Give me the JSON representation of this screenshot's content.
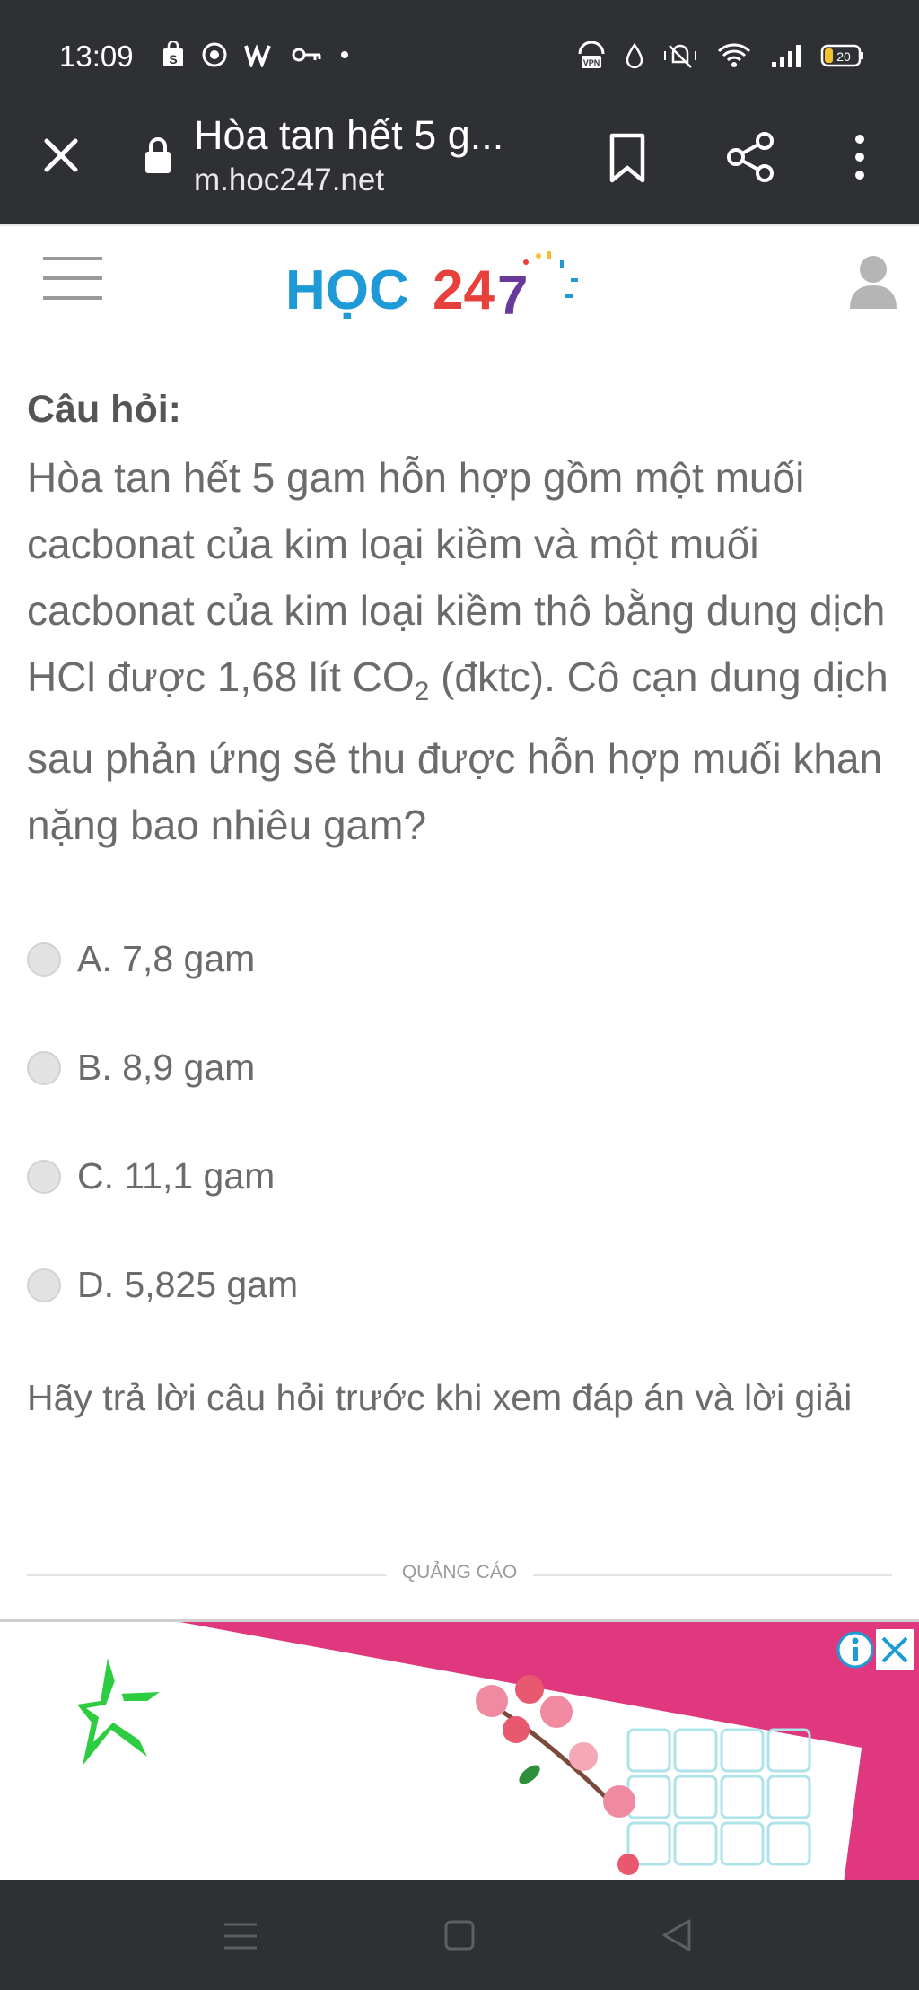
{
  "status_bar": {
    "time": "13:09",
    "battery": "20",
    "left_icons": [
      "shopping-bag-icon",
      "chrome-icon",
      "w-app-icon",
      "key-icon",
      "dot-icon"
    ],
    "right_icons": [
      "vpn-icon",
      "drop-icon",
      "mute-icon",
      "wifi-icon",
      "signal-icon",
      "battery-icon"
    ]
  },
  "browser_toolbar": {
    "page_title": "Hòa tan hết 5 g...",
    "url": "m.hoc247.net"
  },
  "site_header": {
    "logo_text_blue": "HỌC",
    "logo_text_red": "24",
    "logo_text_purple": "7"
  },
  "question": {
    "heading": "Câu hỏi:",
    "text_before_co2": "Hòa tan hết 5 gam hỗn hợp gồm một muối cacbonat của kim loại kiềm và một muối cacbonat của kim loại kiềm thô bằng dung dịch HCl được 1,68 lít ",
    "co2_main": "CO",
    "co2_sub": "2",
    "text_after_co2": " (đktc). Cô cạn dung dịch sau phản ứng sẽ thu được hỗn hợp muối khan nặng bao nhiêu gam?"
  },
  "options": [
    {
      "label": "A. 7,8 gam"
    },
    {
      "label": "B. 8,9 gam"
    },
    {
      "label": "C. 11,1 gam"
    },
    {
      "label": "D. 5,825 gam"
    }
  ],
  "notice": "Hãy trả lời câu hỏi trước khi xem đáp án và lời giải",
  "ad": {
    "label": "QUẢNG CÁO"
  },
  "colors": {
    "bar_bg": "#2e3033",
    "logo_blue": "#1e9ad6",
    "logo_red": "#e8413c",
    "logo_purple": "#6a3a9a",
    "ad_pink": "#e0387e",
    "text_gray": "#6b6b6b"
  }
}
